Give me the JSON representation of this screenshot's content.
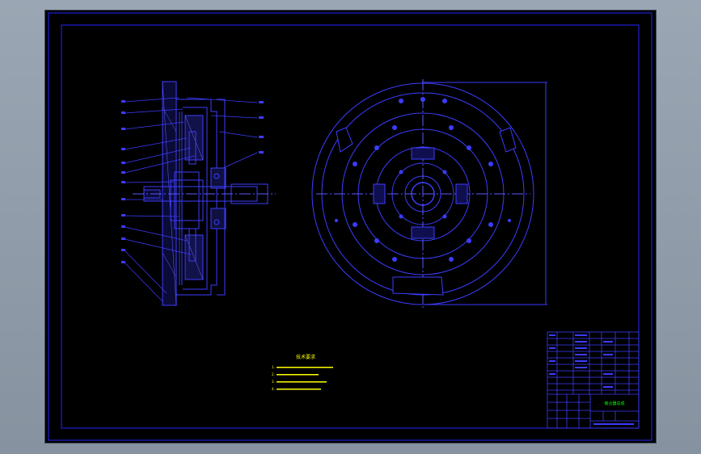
{
  "drawing": {
    "technical_requirements": {
      "title": "技术要求",
      "items": [
        "1.",
        "2.",
        "3.",
        "4."
      ]
    },
    "title_block": {
      "project_name": "离合器总成",
      "school": "",
      "drawing_no": ""
    },
    "colors": {
      "background": "#000000",
      "frame": "#2424ff",
      "lines": "#3c3cff",
      "center_lines": "#5a5aff",
      "notes": "#ffff00",
      "highlight": "#00ff00",
      "hatch": "#8a8aff",
      "viewer_bg": "#8e9aa8"
    }
  }
}
